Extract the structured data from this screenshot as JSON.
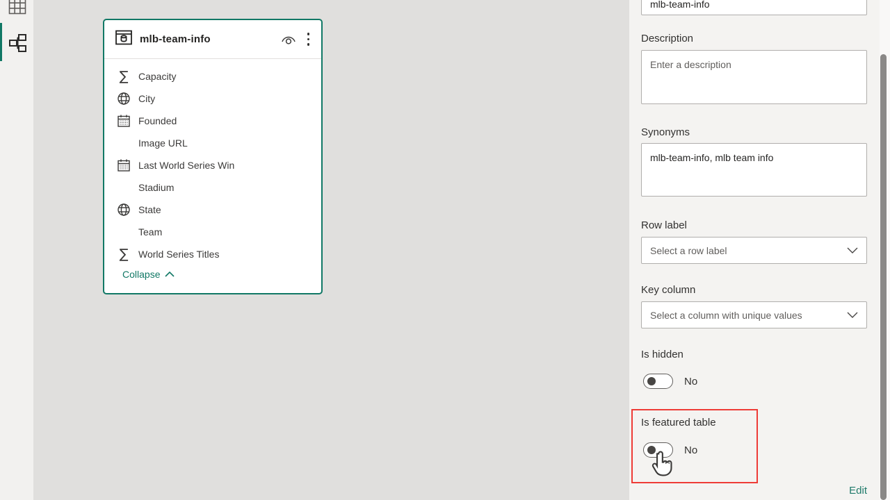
{
  "left_rail": {
    "items": [
      {
        "name": "table-view",
        "selected": false
      },
      {
        "name": "model-view",
        "selected": true
      }
    ]
  },
  "canvas": {
    "table_card": {
      "title": "mlb-team-info",
      "fields": [
        {
          "label": "Capacity",
          "icon": "sigma"
        },
        {
          "label": "City",
          "icon": "globe"
        },
        {
          "label": "Founded",
          "icon": "calendar"
        },
        {
          "label": "Image URL",
          "icon": "none"
        },
        {
          "label": "Last World Series Win",
          "icon": "calendar"
        },
        {
          "label": "Stadium",
          "icon": "none"
        },
        {
          "label": "State",
          "icon": "globe"
        },
        {
          "label": "Team",
          "icon": "none"
        },
        {
          "label": "World Series Titles",
          "icon": "sigma"
        }
      ],
      "collapse_label": "Collapse"
    }
  },
  "properties_panel": {
    "name_field": {
      "value": "mlb-team-info"
    },
    "description": {
      "label": "Description",
      "placeholder": "Enter a description",
      "value": ""
    },
    "synonyms": {
      "label": "Synonyms",
      "value": "mlb-team-info, mlb team info"
    },
    "row_label": {
      "label": "Row label",
      "placeholder": "Select a row label"
    },
    "key_column": {
      "label": "Key column",
      "placeholder": "Select a column with unique values"
    },
    "is_hidden": {
      "label": "Is hidden",
      "value": "No",
      "state": "off"
    },
    "is_featured_table": {
      "label": "Is featured table",
      "value": "No",
      "state": "off",
      "highlighted": true
    },
    "edit_label": "Edit"
  },
  "colors": {
    "accent_teal": "#117865",
    "highlight_red": "#ee3b36",
    "canvas_bg": "#e0dfdd",
    "panel_bg": "#f4f3f1"
  }
}
